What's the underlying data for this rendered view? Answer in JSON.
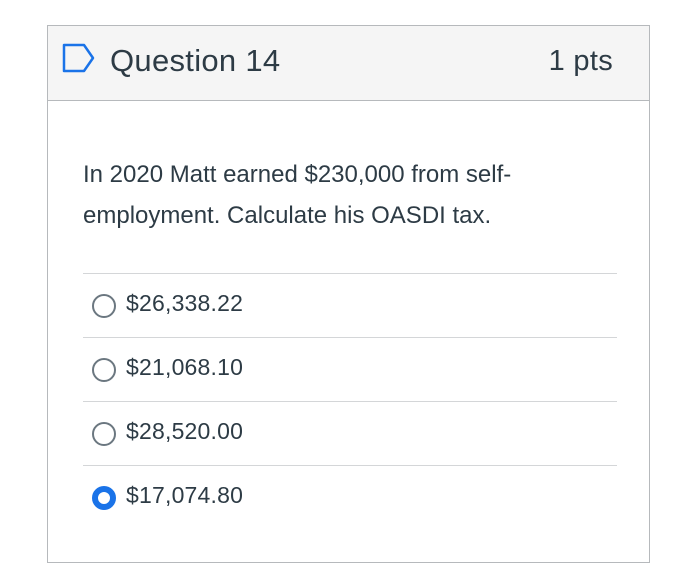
{
  "question": {
    "title": "Question 14",
    "points": "1 pts",
    "text": "In 2020 Matt earned $230,000 from self-employment. Calculate his OASDI tax.",
    "flag_icon": "flag-outline-icon"
  },
  "answers": [
    {
      "label": "$26,338.22",
      "selected": false
    },
    {
      "label": "$21,068.10",
      "selected": false
    },
    {
      "label": "$28,520.00",
      "selected": false
    },
    {
      "label": "$17,074.80",
      "selected": true
    }
  ],
  "colors": {
    "header_bg": "#f5f5f5",
    "border": "#b6b9bc",
    "text": "#2d3b45",
    "accent": "#1a73e8",
    "flag_icon": "#1a73e8"
  }
}
